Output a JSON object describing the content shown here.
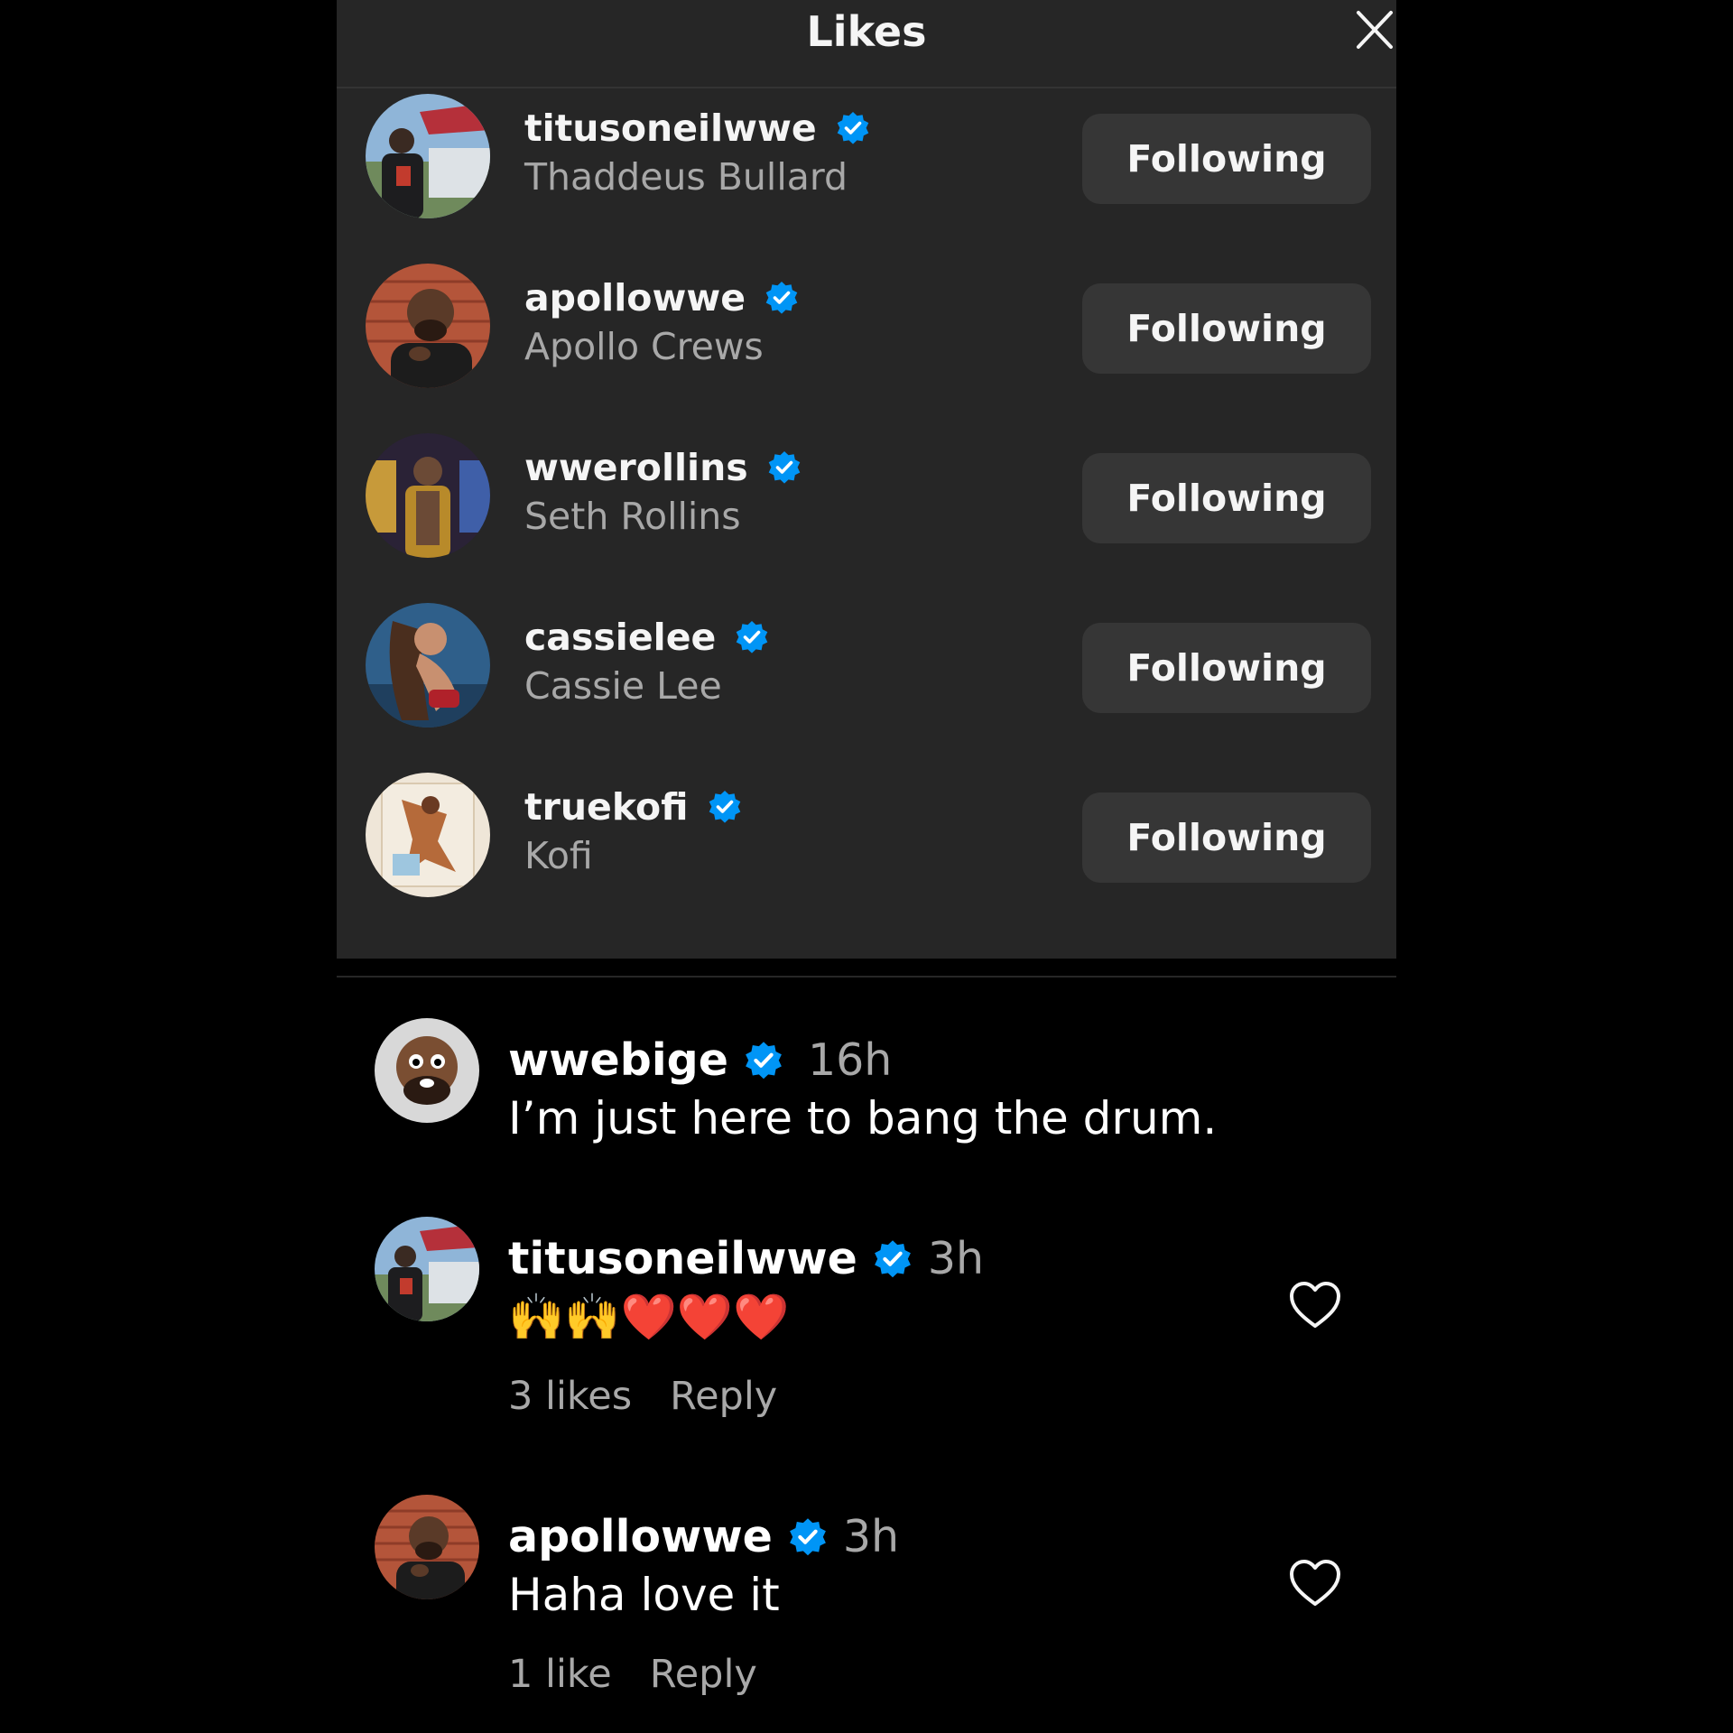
{
  "panel": {
    "title": "Likes",
    "close_icon": "close-icon",
    "likes": [
      {
        "username": "titusoneilwwe",
        "full_name": "Thaddeus Bullard",
        "button": "Following",
        "avatar": "avatar-titus"
      },
      {
        "username": "apollowwe",
        "full_name": "Apollo Crews",
        "button": "Following",
        "avatar": "avatar-apollo"
      },
      {
        "username": "wwerollins",
        "full_name": "Seth Rollins",
        "button": "Following",
        "avatar": "avatar-rollins"
      },
      {
        "username": "cassielee",
        "full_name": "Cassie Lee",
        "button": "Following",
        "avatar": "avatar-cassie"
      },
      {
        "username": "truekofi",
        "full_name": "Kofi",
        "button": "Following",
        "avatar": "avatar-kofi"
      }
    ]
  },
  "comments": [
    {
      "username": "wwebige",
      "time": "16h",
      "text": "I’m just here to bang the drum.",
      "likes": "",
      "reply": ""
    },
    {
      "username": "titusoneilwwe",
      "time": "3h",
      "text": "🙌🙌❤️❤️❤️",
      "likes": "3 likes",
      "reply": "Reply"
    },
    {
      "username": "apollowwe",
      "time": "3h",
      "text": "Haha love it",
      "likes": "1 like",
      "reply": "Reply"
    }
  ],
  "colors": {
    "panel_bg": "#262626",
    "button_bg": "#363636",
    "secondary_text": "#a8a8a8",
    "verified_blue": "#0095f6"
  }
}
